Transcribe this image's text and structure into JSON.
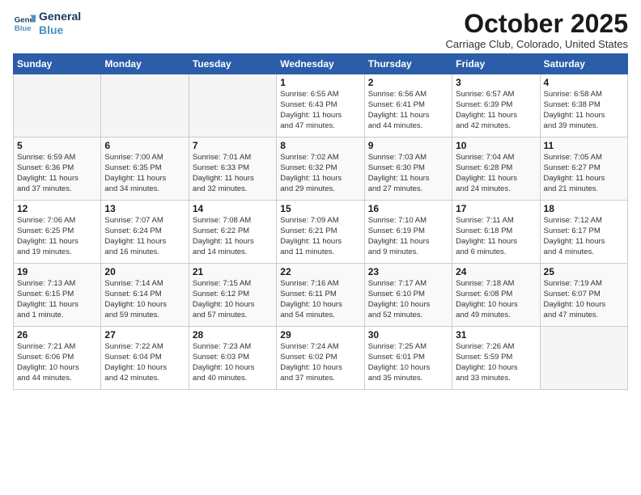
{
  "header": {
    "logo_line1": "General",
    "logo_line2": "Blue",
    "month_title": "October 2025",
    "location": "Carriage Club, Colorado, United States"
  },
  "days_of_week": [
    "Sunday",
    "Monday",
    "Tuesday",
    "Wednesday",
    "Thursday",
    "Friday",
    "Saturday"
  ],
  "weeks": [
    [
      {
        "day": "",
        "info": ""
      },
      {
        "day": "",
        "info": ""
      },
      {
        "day": "",
        "info": ""
      },
      {
        "day": "1",
        "info": "Sunrise: 6:55 AM\nSunset: 6:43 PM\nDaylight: 11 hours\nand 47 minutes."
      },
      {
        "day": "2",
        "info": "Sunrise: 6:56 AM\nSunset: 6:41 PM\nDaylight: 11 hours\nand 44 minutes."
      },
      {
        "day": "3",
        "info": "Sunrise: 6:57 AM\nSunset: 6:39 PM\nDaylight: 11 hours\nand 42 minutes."
      },
      {
        "day": "4",
        "info": "Sunrise: 6:58 AM\nSunset: 6:38 PM\nDaylight: 11 hours\nand 39 minutes."
      }
    ],
    [
      {
        "day": "5",
        "info": "Sunrise: 6:59 AM\nSunset: 6:36 PM\nDaylight: 11 hours\nand 37 minutes."
      },
      {
        "day": "6",
        "info": "Sunrise: 7:00 AM\nSunset: 6:35 PM\nDaylight: 11 hours\nand 34 minutes."
      },
      {
        "day": "7",
        "info": "Sunrise: 7:01 AM\nSunset: 6:33 PM\nDaylight: 11 hours\nand 32 minutes."
      },
      {
        "day": "8",
        "info": "Sunrise: 7:02 AM\nSunset: 6:32 PM\nDaylight: 11 hours\nand 29 minutes."
      },
      {
        "day": "9",
        "info": "Sunrise: 7:03 AM\nSunset: 6:30 PM\nDaylight: 11 hours\nand 27 minutes."
      },
      {
        "day": "10",
        "info": "Sunrise: 7:04 AM\nSunset: 6:28 PM\nDaylight: 11 hours\nand 24 minutes."
      },
      {
        "day": "11",
        "info": "Sunrise: 7:05 AM\nSunset: 6:27 PM\nDaylight: 11 hours\nand 21 minutes."
      }
    ],
    [
      {
        "day": "12",
        "info": "Sunrise: 7:06 AM\nSunset: 6:25 PM\nDaylight: 11 hours\nand 19 minutes."
      },
      {
        "day": "13",
        "info": "Sunrise: 7:07 AM\nSunset: 6:24 PM\nDaylight: 11 hours\nand 16 minutes."
      },
      {
        "day": "14",
        "info": "Sunrise: 7:08 AM\nSunset: 6:22 PM\nDaylight: 11 hours\nand 14 minutes."
      },
      {
        "day": "15",
        "info": "Sunrise: 7:09 AM\nSunset: 6:21 PM\nDaylight: 11 hours\nand 11 minutes."
      },
      {
        "day": "16",
        "info": "Sunrise: 7:10 AM\nSunset: 6:19 PM\nDaylight: 11 hours\nand 9 minutes."
      },
      {
        "day": "17",
        "info": "Sunrise: 7:11 AM\nSunset: 6:18 PM\nDaylight: 11 hours\nand 6 minutes."
      },
      {
        "day": "18",
        "info": "Sunrise: 7:12 AM\nSunset: 6:17 PM\nDaylight: 11 hours\nand 4 minutes."
      }
    ],
    [
      {
        "day": "19",
        "info": "Sunrise: 7:13 AM\nSunset: 6:15 PM\nDaylight: 11 hours\nand 1 minute."
      },
      {
        "day": "20",
        "info": "Sunrise: 7:14 AM\nSunset: 6:14 PM\nDaylight: 10 hours\nand 59 minutes."
      },
      {
        "day": "21",
        "info": "Sunrise: 7:15 AM\nSunset: 6:12 PM\nDaylight: 10 hours\nand 57 minutes."
      },
      {
        "day": "22",
        "info": "Sunrise: 7:16 AM\nSunset: 6:11 PM\nDaylight: 10 hours\nand 54 minutes."
      },
      {
        "day": "23",
        "info": "Sunrise: 7:17 AM\nSunset: 6:10 PM\nDaylight: 10 hours\nand 52 minutes."
      },
      {
        "day": "24",
        "info": "Sunrise: 7:18 AM\nSunset: 6:08 PM\nDaylight: 10 hours\nand 49 minutes."
      },
      {
        "day": "25",
        "info": "Sunrise: 7:19 AM\nSunset: 6:07 PM\nDaylight: 10 hours\nand 47 minutes."
      }
    ],
    [
      {
        "day": "26",
        "info": "Sunrise: 7:21 AM\nSunset: 6:06 PM\nDaylight: 10 hours\nand 44 minutes."
      },
      {
        "day": "27",
        "info": "Sunrise: 7:22 AM\nSunset: 6:04 PM\nDaylight: 10 hours\nand 42 minutes."
      },
      {
        "day": "28",
        "info": "Sunrise: 7:23 AM\nSunset: 6:03 PM\nDaylight: 10 hours\nand 40 minutes."
      },
      {
        "day": "29",
        "info": "Sunrise: 7:24 AM\nSunset: 6:02 PM\nDaylight: 10 hours\nand 37 minutes."
      },
      {
        "day": "30",
        "info": "Sunrise: 7:25 AM\nSunset: 6:01 PM\nDaylight: 10 hours\nand 35 minutes."
      },
      {
        "day": "31",
        "info": "Sunrise: 7:26 AM\nSunset: 5:59 PM\nDaylight: 10 hours\nand 33 minutes."
      },
      {
        "day": "",
        "info": ""
      }
    ]
  ]
}
